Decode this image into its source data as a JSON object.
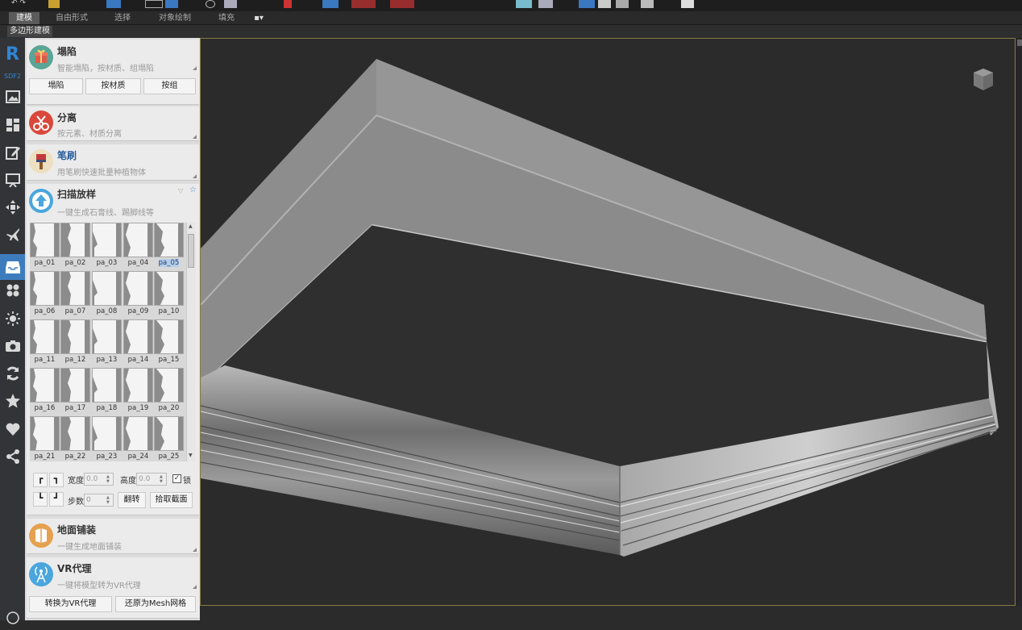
{
  "ribbon": {
    "tabs": [
      "建模",
      "自由形式",
      "选择",
      "对象绘制",
      "填充"
    ],
    "active_tab": "建模",
    "sub_tab": "多边形建模"
  },
  "iconbar": {
    "logo": "R",
    "logo_sub": "SDF2",
    "icons": [
      "image-icon",
      "layout-icon",
      "edit-icon",
      "presentation-icon",
      "move-icon",
      "airplane-icon",
      "inbox-icon",
      "dots-icon",
      "sun-icon",
      "camera-icon",
      "refresh-icon",
      "star-icon",
      "heart-icon",
      "share-icon"
    ],
    "selected": "inbox-icon"
  },
  "cards": {
    "collapse": {
      "title": "塌陷",
      "subtitle": "智能塌陷，按材质、组塌陷",
      "buttons": [
        "塌陷",
        "按材质",
        "按组"
      ]
    },
    "separate": {
      "title": "分离",
      "subtitle": "按元素、材质分离"
    },
    "brush": {
      "title": "笔刷",
      "subtitle": "用笔刷快速批量种植物体"
    },
    "sweep": {
      "title": "扫描放样",
      "subtitle": "一键生成石膏线、踢脚线等"
    },
    "floor": {
      "title": "地面铺装",
      "subtitle": "一键生成地面铺装"
    },
    "vr": {
      "title": "VR代理",
      "subtitle": "一键将模型转为VR代理",
      "buttons": [
        "转换为VR代理",
        "还原为Mesh网格"
      ]
    }
  },
  "profiles": [
    "pa_01",
    "pa_02",
    "pa_03",
    "pa_04",
    "pa_05",
    "pa_06",
    "pa_07",
    "pa_08",
    "pa_09",
    "pa_10",
    "pa_11",
    "pa_12",
    "pa_13",
    "pa_14",
    "pa_15",
    "pa_16",
    "pa_17",
    "pa_18",
    "pa_19",
    "pa_20",
    "pa_21",
    "pa_22",
    "pa_23",
    "pa_24",
    "pa_25"
  ],
  "selected_profile": "pa_05",
  "controls": {
    "width_label": "宽度",
    "width_value": "0.0",
    "height_label": "高度",
    "height_value": "0.0",
    "lock_label": "锁",
    "lock_checked": true,
    "steps_label": "步数",
    "steps_value": "0",
    "flip_button": "翻转",
    "pick_button": "拾取截面"
  },
  "colors": {
    "selection_blue": "#3e7dbd",
    "viewport_bg": "#2b2b2b",
    "viewport_border": "#8a7a40"
  }
}
